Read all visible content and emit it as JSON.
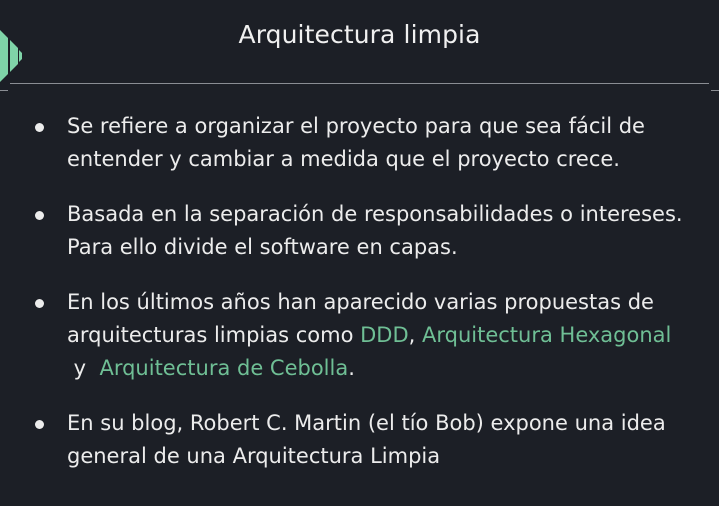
{
  "slide": {
    "title": "Arquitectura limpia",
    "accent_color": "#6fbf95",
    "logo_icon": "brand-chevron-logo",
    "bullets": [
      {
        "text": "Se refiere a organizar el proyecto para que sea fácil de entender y cambiar a medida que el proyecto crece."
      },
      {
        "text": "Basada en la separación de responsabilidades o intereses. Para ello divide el software en capas."
      },
      {
        "text_before": "En los últimos años han aparecido varias propuestas de arquitecturas limpias como ",
        "link1": "DDD",
        "sep1": ", ",
        "link2": "Arquitectura Hexagonal",
        "sep2": " y  ",
        "link3": "Arquitectura de Cebolla",
        "text_after": "."
      },
      {
        "text": "En su blog, Robert C. Martin (el tío Bob) expone una idea general de una Arquitectura Limpia"
      }
    ]
  }
}
